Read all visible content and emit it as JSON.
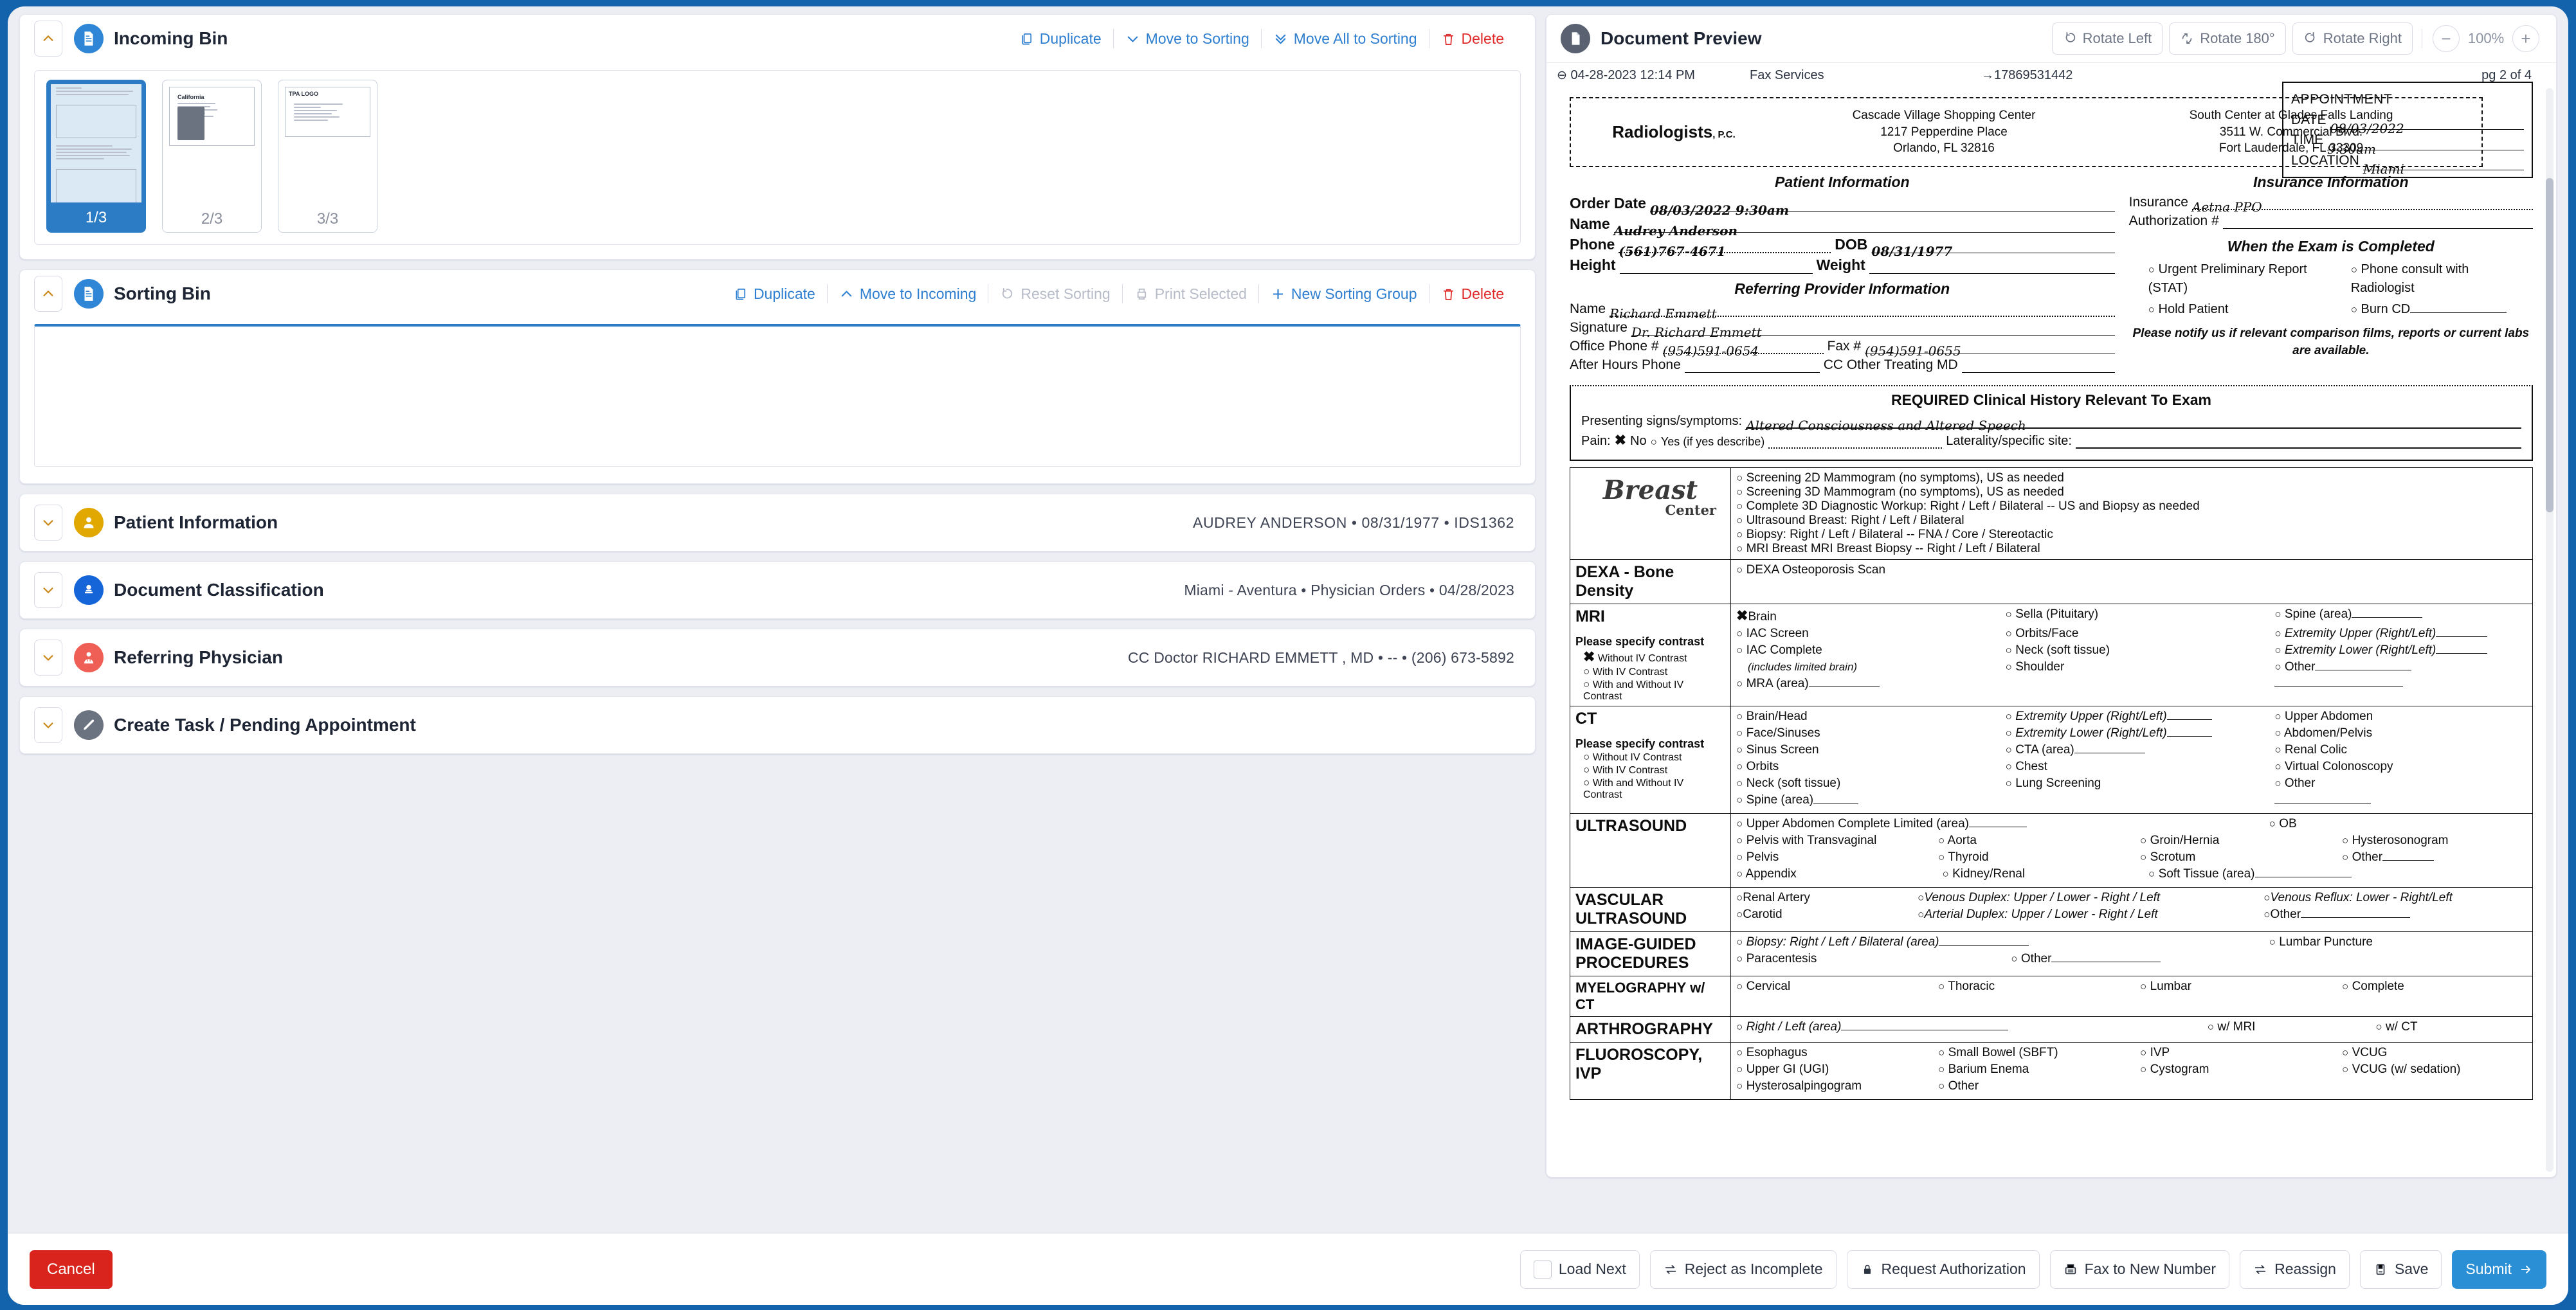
{
  "incoming_bin": {
    "title": "Incoming Bin",
    "icon": "document-incoming-icon",
    "actions": [
      {
        "label": "Duplicate",
        "icon": "copy-icon",
        "style": "link"
      },
      {
        "label": "Move to Sorting",
        "icon": "chevron-down-icon",
        "style": "link"
      },
      {
        "label": "Move All to Sorting",
        "icon": "chevron-double-down-icon",
        "style": "link"
      },
      {
        "label": "Delete",
        "icon": "trash-icon",
        "style": "danger"
      }
    ],
    "thumbnails": [
      {
        "label": "1/3",
        "selected": true,
        "kind": "physician-order-form"
      },
      {
        "label": "2/3",
        "selected": false,
        "kind": "drivers-license"
      },
      {
        "label": "3/3",
        "selected": false,
        "kind": "insurance-card"
      }
    ]
  },
  "sorting_bin": {
    "title": "Sorting Bin",
    "icon": "document-sorting-icon",
    "actions": [
      {
        "label": "Duplicate",
        "icon": "copy-icon",
        "style": "link"
      },
      {
        "label": "Move to Incoming",
        "icon": "chevron-up-icon",
        "style": "link"
      },
      {
        "label": "Reset Sorting",
        "icon": "reset-icon",
        "style": "disabled"
      },
      {
        "label": "Print Selected",
        "icon": "printer-icon",
        "style": "disabled"
      },
      {
        "label": "New Sorting Group",
        "icon": "plus-icon",
        "style": "link"
      },
      {
        "label": "Delete",
        "icon": "trash-icon",
        "style": "danger"
      }
    ]
  },
  "accordions": [
    {
      "title": "Patient Information",
      "icon": "person-icon",
      "icon_color": "#e0a800",
      "summary": "AUDREY ANDERSON  •  08/31/1977  •  IDS1362",
      "caps": true
    },
    {
      "title": "Document Classification",
      "icon": "stamp-icon",
      "icon_color": "#1565d8",
      "summary": "Miami - Aventura  •  Physician Orders  •  04/28/2023",
      "caps": false
    },
    {
      "title": "Referring Physician",
      "icon": "doctor-icon",
      "icon_color": "#ef5f56",
      "summary": "CC Doctor RICHARD EMMETT , MD  •  --  •  (206) 673-5892",
      "caps": false
    },
    {
      "title": "Create Task / Pending Appointment",
      "icon": "pencil-icon",
      "icon_color": "#6b7280",
      "summary": "",
      "caps": false
    }
  ],
  "preview": {
    "title": "Document Preview",
    "icon": "document-preview-icon",
    "rotate_left": "Rotate Left",
    "rotate_180": "Rotate 180°",
    "rotate_right": "Rotate Right",
    "zoom_level": "100%",
    "zoom_out": "−",
    "zoom_in": "+",
    "fax_header": {
      "datetime": "04-28-2023 12:14 PM",
      "sender": "Fax Services",
      "number": "17869531442",
      "page": "pg 2 of 4"
    }
  },
  "document": {
    "appointment": {
      "heading": "APPOINTMENT",
      "date_label": "DATE",
      "date_value": "08/03/2022",
      "time_label": "TIME",
      "time_value": "9:30am",
      "location_label": "LOCATION",
      "location_value": "Miami"
    },
    "letterhead": {
      "brand": "Radiologists",
      "brand_suffix": ", P.C.",
      "offices": [
        {
          "name": "Cascade Village Shopping Center",
          "line1": "1217 Pepperdine Place",
          "line2": "Orlando, FL 32816"
        },
        {
          "name": "South Center at Glades Falls Landing",
          "line1": "3511 W. Commercial Blvd.",
          "line2": "Fort Lauderdale, FL 33309"
        }
      ]
    },
    "patient_section": {
      "heading": "Patient Information",
      "order_date_label": "Order Date",
      "order_date_value": "08/03/2022 9:30am",
      "name_label": "Name",
      "name_value": "Audrey Anderson",
      "phone_label": "Phone",
      "phone_value": "(561)767-4671",
      "dob_label": "DOB",
      "dob_value": "08/31/1977",
      "height_label": "Height",
      "height_value": "",
      "weight_label": "Weight",
      "weight_value": ""
    },
    "provider_section": {
      "heading": "Referring Provider Information",
      "name_label": "Name",
      "name_value": "Richard Emmett",
      "signature_label": "Signature",
      "signature_value": "Dr. Richard Emmett",
      "office_phone_label": "Office Phone #",
      "office_phone_value": "(954)591-0654",
      "fax_label": "Fax #",
      "fax_value": "(954)591-0655",
      "after_hours_label": "After Hours Phone",
      "cc_label": "CC Other Treating MD"
    },
    "insurance_section": {
      "heading": "Insurance Information",
      "insurance_label": "Insurance",
      "insurance_value": "Aetna PPO",
      "auth_label": "Authorization #",
      "auth_value": ""
    },
    "exam_completed": {
      "heading": "When the Exam is Completed",
      "options_left": [
        "Urgent Preliminary Report (STAT)",
        "Hold Patient"
      ],
      "options_right": [
        "Phone consult with Radiologist",
        "Burn CD"
      ],
      "note": "Please notify us if relevant comparison films, reports or current labs are available."
    },
    "clinical_history": {
      "heading": "REQUIRED Clinical History Relevant To Exam",
      "symptoms_label": "Presenting signs/symptoms:",
      "symptoms_value": "Altered Consciousness and Altered Speech",
      "pain_label": "Pain:",
      "pain_no": "No",
      "pain_yes": "Yes (if yes describe)",
      "pain_selected": "No",
      "laterality_label": "Laterality/specific site:"
    },
    "modalities": [
      {
        "name": "Breast Center",
        "logo": true,
        "options": [
          "Screening 2D Mammogram (no symptoms), US as needed",
          "Screening 3D Mammogram (no symptoms), US as needed",
          "Complete 3D Diagnostic Workup:  Right / Left / Bilateral -- US and Biopsy as needed",
          "Ultrasound Breast:  Right / Left / Bilateral",
          "Biopsy: Right / Left / Bilateral -- FNA / Core / Stereotactic",
          "MRI Breast            MRI Breast Biopsy -- Right / Left / Bilateral"
        ]
      },
      {
        "name": "DEXA - Bone Density",
        "options": [
          "DEXA Osteoporosis Scan"
        ]
      },
      {
        "name": "MRI",
        "contrast_label": "Please specify contrast",
        "contrast_options": [
          "Without IV Contrast",
          "With IV Contrast",
          "With and Without IV Contrast"
        ],
        "contrast_selected": "Without IV Contrast",
        "checked": [
          "Brain"
        ],
        "columns": [
          [
            "Brain",
            "IAC Screen",
            "IAC Complete",
            "(includes limited brain)",
            "MRA (area)"
          ],
          [
            "Sella (Pituitary)",
            "Orbits/Face",
            "Neck (soft tissue)",
            "Shoulder"
          ],
          [
            "Spine (area)",
            "Extremity Upper (Right/Left)",
            "Extremity Lower (Right/Left)",
            "Other"
          ]
        ]
      },
      {
        "name": "CT",
        "contrast_label": "Please specify contrast",
        "contrast_options": [
          "Without IV Contrast",
          "With IV Contrast",
          "With and Without IV Contrast"
        ],
        "columns": [
          [
            "Brain/Head",
            "Face/Sinuses",
            "Sinus Screen",
            "Orbits",
            "Neck (soft tissue)",
            "Spine (area)"
          ],
          [
            "Extremity Upper (Right/Left)",
            "Extremity Lower (Right/Left)",
            "CTA (area)",
            "Chest",
            "Lung Screening"
          ],
          [
            "Upper Abdomen",
            "Abdomen/Pelvis",
            "Renal Colic",
            "Virtual Colonoscopy",
            "Other"
          ]
        ]
      },
      {
        "name": "ULTRASOUND",
        "columns": [
          [
            "Upper Abdomen   Complete   Limited (area)",
            "Pelvis with Transvaginal",
            "Pelvis",
            "Appendix"
          ],
          [
            "Aorta",
            "Thyroid",
            "Kidney/Renal"
          ],
          [
            "Groin/Hernia",
            "Scrotum",
            "Soft Tissue (area)"
          ],
          [
            "OB",
            "Hysterosonogram",
            "Other"
          ]
        ]
      },
      {
        "name": "VASCULAR ULTRASOUND",
        "columns": [
          [
            "Renal Artery",
            "Carotid"
          ],
          [
            "Venous Duplex: Upper / Lower - Right / Left",
            "Arterial Duplex: Upper / Lower - Right / Left"
          ],
          [
            "Venous Reflux: Lower - Right/Left",
            "Other"
          ]
        ]
      },
      {
        "name": "IMAGE-GUIDED PROCEDURES",
        "columns": [
          [
            "Biopsy: Right / Left / Bilateral (area)",
            "Paracentesis"
          ],
          [
            "Other"
          ],
          [
            "Lumbar Puncture"
          ]
        ]
      },
      {
        "name": "MYELOGRAPHY w/ CT",
        "columns": [
          [
            "Cervical"
          ],
          [
            "Thoracic"
          ],
          [
            "Lumbar"
          ],
          [
            "Complete"
          ]
        ]
      },
      {
        "name": "ARTHROGRAPHY",
        "columns": [
          [
            "Right / Left (area)"
          ],
          [
            "w/ MRI"
          ],
          [
            "w/ CT"
          ]
        ]
      },
      {
        "name": "FLUOROSCOPY, IVP",
        "columns": [
          [
            "Esophagus",
            "Upper GI (UGI)",
            "Hysterosalpingogram"
          ],
          [
            "Small Bowel (SBFT)",
            "Barium Enema",
            "Other"
          ],
          [
            "IVP",
            "Cystogram"
          ],
          [
            "VCUG",
            "VCUG (w/ sedation)"
          ]
        ]
      }
    ]
  },
  "action_bar": {
    "cancel": "Cancel",
    "load_next": "Load Next",
    "buttons": [
      {
        "label": "Reject as Incomplete",
        "icon": "swap-icon"
      },
      {
        "label": "Request Authorization",
        "icon": "lock-icon"
      },
      {
        "label": "Fax to New Number",
        "icon": "fax-icon"
      },
      {
        "label": "Reassign",
        "icon": "swap-icon"
      },
      {
        "label": "Save",
        "icon": "save-icon"
      }
    ],
    "submit": "Submit",
    "submit_icon": "arrow-right-icon"
  },
  "colors": {
    "accent_blue": "#2f7fd1",
    "danger_red": "#e02b2b",
    "frame_blue": "#1263ab",
    "primary_button": "#2b8fd6",
    "cancel_red": "#d8241c"
  }
}
